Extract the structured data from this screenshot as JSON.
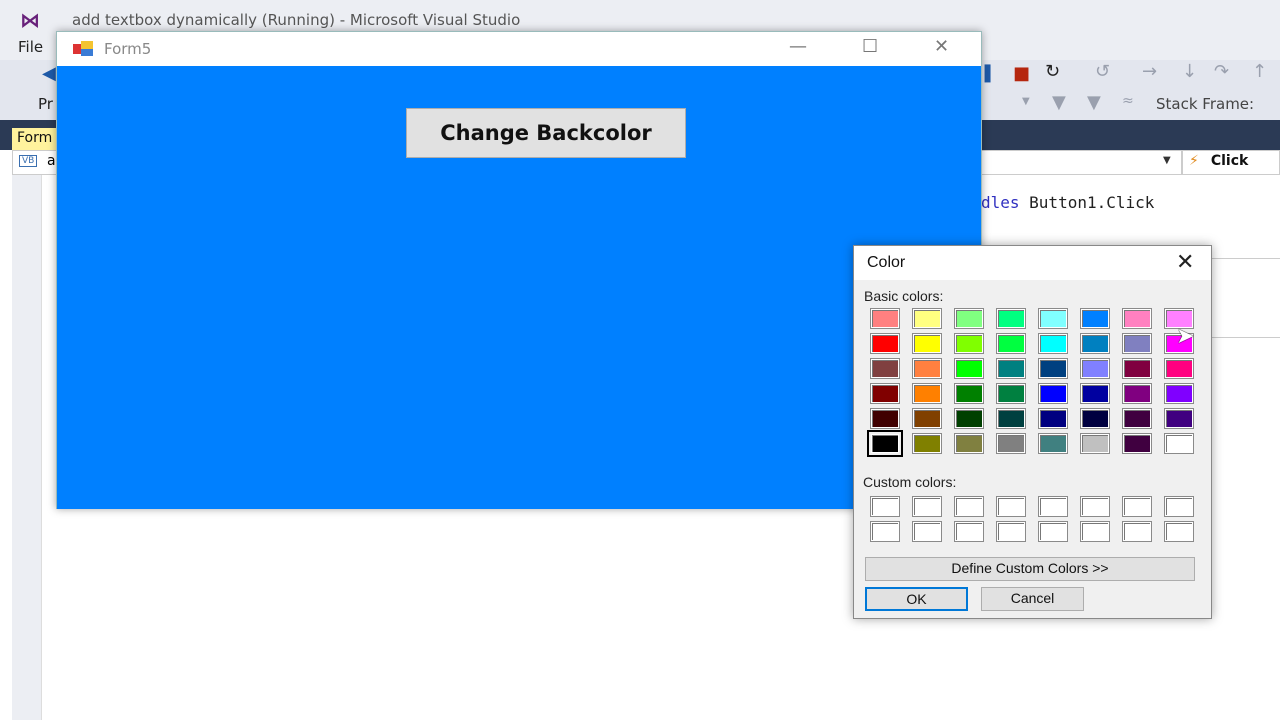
{
  "vs": {
    "title": "add textbox dynamically (Running) - Microsoft Visual Studio",
    "menu_file": "File",
    "toolbar_partial": "Pr",
    "stack_frame_label": "Stack Frame:",
    "doc_tab": "Form",
    "nav_left_badge": "VB",
    "nav_left_text": "a",
    "nav_event": "Click",
    "code_line_keyword": "dles",
    "code_line_rest": " Button1.Click"
  },
  "form5": {
    "title": "Form5",
    "button_label": "Change Backcolor",
    "backcolor": "#0080FF"
  },
  "color_dialog": {
    "title": "Color",
    "basic_label": "Basic colors:",
    "custom_label": "Custom colors:",
    "define_button": "Define Custom Colors >>",
    "ok_button": "OK",
    "cancel_button": "Cancel",
    "selected_color": "#000000",
    "basic_colors": [
      [
        "#FF8080",
        "#FFFF80",
        "#80FF80",
        "#00FF80",
        "#80FFFF",
        "#0080FF",
        "#FF80C0",
        "#FF80FF"
      ],
      [
        "#FF0000",
        "#FFFF00",
        "#80FF00",
        "#00FF40",
        "#00FFFF",
        "#0080C0",
        "#8080C0",
        "#FF00FF"
      ],
      [
        "#804040",
        "#FF8040",
        "#00FF00",
        "#008080",
        "#004080",
        "#8080FF",
        "#800040",
        "#FF0080"
      ],
      [
        "#800000",
        "#FF8000",
        "#008000",
        "#008040",
        "#0000FF",
        "#0000A0",
        "#800080",
        "#8000FF"
      ],
      [
        "#400000",
        "#804000",
        "#004000",
        "#004040",
        "#000080",
        "#000040",
        "#400040",
        "#400080"
      ],
      [
        "#000000",
        "#808000",
        "#808040",
        "#808080",
        "#408080",
        "#C0C0C0",
        "#400040",
        "#FFFFFF"
      ]
    ],
    "custom_colors": [
      [
        "#FFFFFF",
        "#FFFFFF",
        "#FFFFFF",
        "#FFFFFF",
        "#FFFFFF",
        "#FFFFFF",
        "#FFFFFF",
        "#FFFFFF"
      ],
      [
        "#FFFFFF",
        "#FFFFFF",
        "#FFFFFF",
        "#FFFFFF",
        "#FFFFFF",
        "#FFFFFF",
        "#FFFFFF",
        "#FFFFFF"
      ]
    ]
  }
}
